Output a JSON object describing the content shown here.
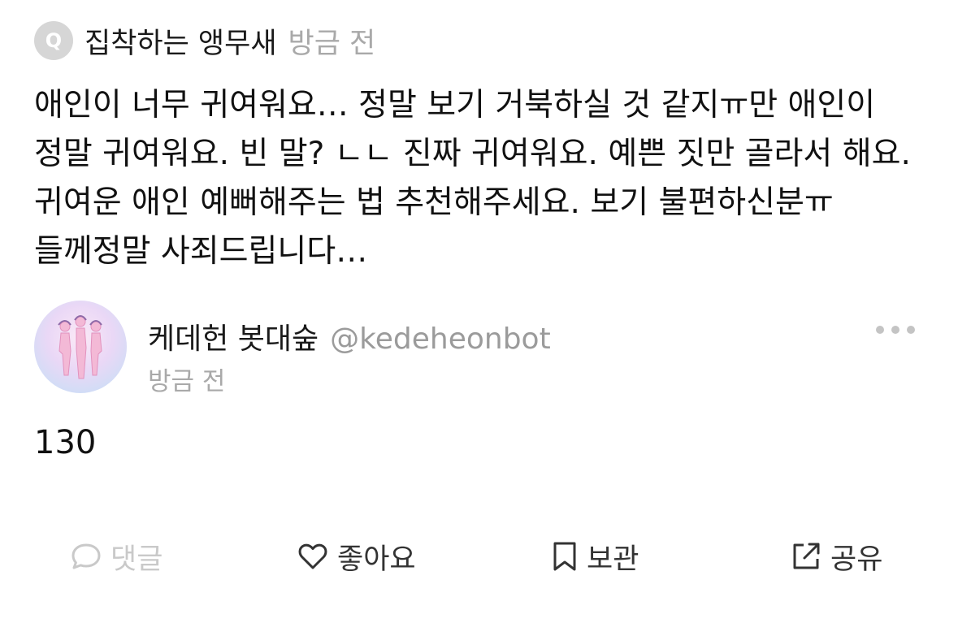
{
  "question_header": {
    "badge": "Q",
    "asker": "집착하는 앵무새",
    "time": "방금 전"
  },
  "question": {
    "text": "애인이 너무 귀여워요… 정말 보기 거북하실 것 같지ㅠ만 애인이 정말 귀여워요. 빈 말? ㄴㄴ 진짜 귀여워요. 예쁜 짓만 골라서 해요. 귀여운 애인 예뻐해주는 법 추천해주세요. 보기 불편하신분ㅠ 들께정말 사죄드립니다…"
  },
  "answer_header": {
    "name": "케데헌 봇대숲",
    "handle": "@kedeheonbot",
    "time": "방금 전"
  },
  "answer": {
    "text": "130"
  },
  "actions": {
    "comment": "댓글",
    "like": "좋아요",
    "save": "보관",
    "share": "공유"
  },
  "icons": {
    "more": "more-horizontal-icon",
    "comment": "speech-bubble-icon",
    "like": "heart-icon",
    "save": "bookmark-icon",
    "share": "share-external-icon"
  },
  "colors": {
    "text": "#111111",
    "muted": "#a9a9a9",
    "disabled": "#c9c9c9",
    "badge": "#d6d6d6"
  }
}
